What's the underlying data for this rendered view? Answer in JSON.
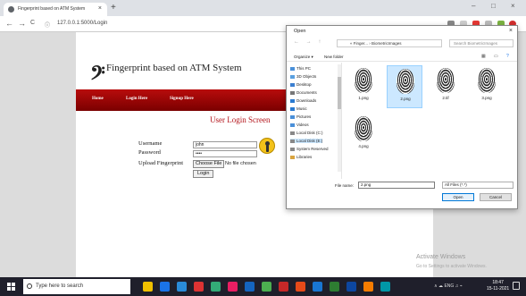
{
  "browser": {
    "tab_title": "Fingerprint based on ATM System",
    "tab_close": "×",
    "new_tab": "+",
    "url": "127.0.0.1:5000/Login",
    "back": "←",
    "forward": "→",
    "reload": "C",
    "window_controls": [
      "–",
      "□",
      "×"
    ]
  },
  "site": {
    "logo_glyph": "𝄢",
    "title": "Fingerprint based on ATM System",
    "nav": [
      "Home",
      "Login Here",
      "Signup Here"
    ],
    "screen_title": "User Login Screen",
    "form": {
      "username_label": "Username",
      "username_value": "john",
      "password_label": "Password",
      "password_value": "••••",
      "upload_label": "Upload Fingerprint",
      "choose_file": "Choose File",
      "no_file": "No file chosen",
      "login_button": "Login"
    }
  },
  "watermark": {
    "line1": "Activate Windows",
    "line2": "Go to Settings to activate Windows."
  },
  "dialog": {
    "title": "Open",
    "close": "×",
    "nav_arrows": "← → ↑",
    "path": "« Finger... › BiometricImages",
    "search_placeholder": "Search BiometricImages",
    "organize": "Organize ▾",
    "new_folder": "New folder",
    "tree": [
      {
        "label": "This PC",
        "color": "#4a90d9"
      },
      {
        "label": "3D Objects",
        "color": "#5aa0e0"
      },
      {
        "label": "Desktop",
        "color": "#3b7fd0"
      },
      {
        "label": "Documents",
        "color": "#777777"
      },
      {
        "label": "Downloads",
        "color": "#2a7ad0"
      },
      {
        "label": "Music",
        "color": "#2a7ad0"
      },
      {
        "label": "Pictures",
        "color": "#4a90d9"
      },
      {
        "label": "Videos",
        "color": "#4a90d9"
      },
      {
        "label": "Local Disk (C:)",
        "color": "#888888"
      },
      {
        "label": "Local Disk (E:)",
        "color": "#888888"
      },
      {
        "label": "System Reserved",
        "color": "#888888"
      },
      {
        "label": "Libraries",
        "color": "#d9a440"
      }
    ],
    "files": [
      {
        "name": "1.png"
      },
      {
        "name": "2.png"
      },
      {
        "name": "2.tif"
      },
      {
        "name": "3.png"
      },
      {
        "name": "4.png"
      }
    ],
    "selected_file": "2.png",
    "file_name_label": "File name:",
    "file_name_value": "2.png",
    "file_type": "All Files (*.*)",
    "open_button": "Open",
    "cancel_button": "Cancel"
  },
  "taskbar": {
    "search_placeholder": "Type here to search",
    "time": "18:47",
    "date": "15-11-2021",
    "tray_text": "∧ ☁ ENG ♫ ⌁",
    "app_colors": [
      "#f0c000",
      "#1a73e8",
      "#2a8bd8",
      "#d33",
      "#3a7",
      "#e91e63",
      "#1565c0",
      "#4caf50",
      "#c62828",
      "#e64a19",
      "#1976d2",
      "#2e7d32",
      "#0d47a1",
      "#f57c00",
      "#0097a7"
    ]
  }
}
